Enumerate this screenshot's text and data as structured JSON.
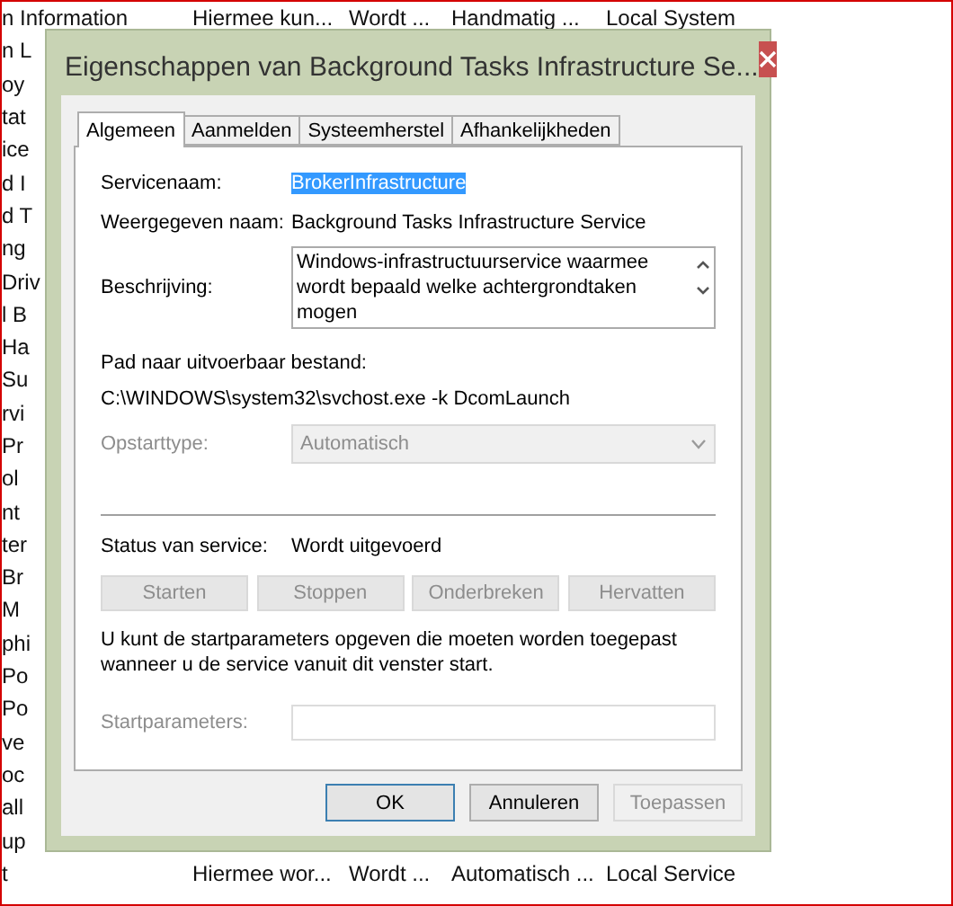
{
  "background_list": {
    "rows": [
      {
        "cells": [
          "n Information",
          "Hiermee kun...",
          "Wordt ...",
          "Handmatig ...",
          "Local System"
        ]
      },
      {
        "cells": [
          "n L"
        ]
      },
      {
        "cells": [
          "oy"
        ]
      },
      {
        "cells": [
          "tat"
        ]
      },
      {
        "cells": [
          "ice"
        ]
      },
      {
        "cells": [
          "d I"
        ]
      },
      {
        "cells": [
          "d T"
        ]
      },
      {
        "cells": [
          "ng"
        ]
      },
      {
        "cells": [
          "Driv"
        ]
      },
      {
        "cells": [
          "l B"
        ]
      },
      {
        "cells": [
          "Ha"
        ]
      },
      {
        "cells": [
          "Su"
        ]
      },
      {
        "cells": [
          "rvi"
        ]
      },
      {
        "cells": [
          "Pr"
        ]
      },
      {
        "cells": [
          "ol"
        ]
      },
      {
        "cells": [
          "nt"
        ]
      },
      {
        "cells": [
          "ter"
        ]
      },
      {
        "cells": [
          "Br"
        ]
      },
      {
        "cells": [
          "M"
        ]
      },
      {
        "cells": [
          "phi"
        ]
      },
      {
        "cells": [
          "Po"
        ]
      },
      {
        "cells": [
          "Po"
        ]
      },
      {
        "cells": [
          "ve"
        ]
      },
      {
        "cells": [
          "oc"
        ]
      },
      {
        "cells": [
          "all"
        ]
      },
      {
        "cells": [
          "up"
        ]
      },
      {
        "cells": [
          "t",
          "Hiermee wor...",
          "Wordt ...",
          "Automatisch ...",
          "Local Service"
        ]
      }
    ]
  },
  "dialog": {
    "title": "Eigenschappen van Background Tasks Infrastructure Se...",
    "tabs": [
      {
        "label": "Algemeen",
        "selected": true
      },
      {
        "label": "Aanmelden",
        "selected": false
      },
      {
        "label": "Systeemherstel",
        "selected": false
      },
      {
        "label": "Afhankelijkheden",
        "selected": false
      }
    ],
    "general": {
      "service_name": {
        "label": "Servicenaam:",
        "value": "BrokerInfrastructure",
        "selected": true
      },
      "display_name": {
        "label": "Weergegeven naam:",
        "value": "Background Tasks Infrastructure Service"
      },
      "description": {
        "label": "Beschrijving:",
        "value": "Windows-infrastructuurservice waarmee wordt bepaald welke achtergrondtaken mogen"
      },
      "path": {
        "label": "Pad naar uitvoerbaar bestand:",
        "value": "C:\\WINDOWS\\system32\\svchost.exe -k DcomLaunch"
      },
      "startup_type": {
        "label": "Opstarttype:",
        "value": "Automatisch",
        "disabled": true
      },
      "status": {
        "label": "Status van service:",
        "value": "Wordt uitgevoerd"
      },
      "service_buttons": [
        {
          "label": "Starten",
          "disabled": true
        },
        {
          "label": "Stoppen",
          "disabled": true
        },
        {
          "label": "Onderbreken",
          "disabled": true
        },
        {
          "label": "Hervatten",
          "disabled": true
        }
      ],
      "hint": "U kunt de startparameters opgeven die moeten worden toegepast wanneer u de service vanuit dit venster start.",
      "start_parameters": {
        "label": "Startparameters:",
        "disabled": true
      }
    },
    "buttons": [
      {
        "label": "OK",
        "default": true,
        "disabled": false
      },
      {
        "label": "Annuleren",
        "default": false,
        "disabled": false
      },
      {
        "label": "Toepassen",
        "default": false,
        "disabled": true
      }
    ]
  }
}
